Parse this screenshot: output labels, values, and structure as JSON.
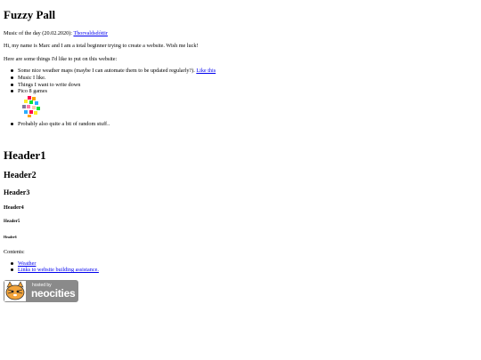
{
  "page": {
    "title": "Fuzzy Pall",
    "music_prefix": "Music of the day (20.02.2020):",
    "music_link": "Thorvaldsdóttir",
    "intro": "Hi, my name is Marc and I am a total beginner trying to create a website. Wish me luck!",
    "wishlist_intro": "Here are some things I'd like to put on this website:",
    "wishlist": [
      {
        "text": "Some nice weather maps (maybe I can automate them to be updated regularly?).",
        "link": "Like this"
      },
      {
        "text": "Music I like."
      },
      {
        "text": "Things I want to write down"
      },
      {
        "text": "Pico 8 games"
      },
      {
        "text": "Probably also quite a bit of random stuff.."
      }
    ],
    "headers": {
      "h1": "Header1",
      "h2": "Header2",
      "h3": "Header3",
      "h4": "Header4",
      "h5": "Header5",
      "h6": "Header6"
    },
    "contents_label": "Contents:",
    "contents": [
      {
        "label": "Weather"
      },
      {
        "label": "Links to website building assistance."
      }
    ],
    "badge": {
      "hosted": "hosted by",
      "brand": "neocities"
    }
  }
}
